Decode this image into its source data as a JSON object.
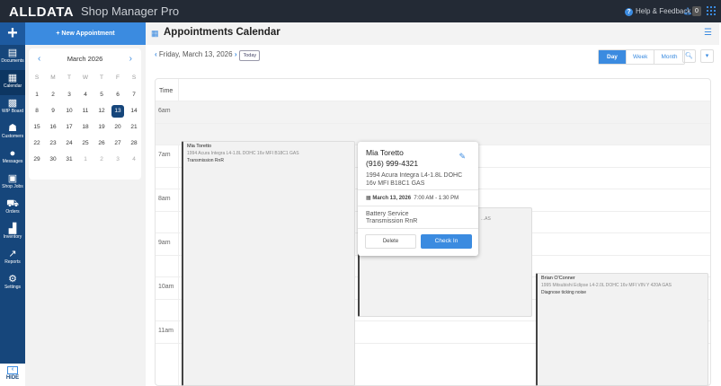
{
  "topbar": {
    "logo": "ALLDATA",
    "product": "Shop Manager Pro",
    "help": "Help & Feedback",
    "notifications": "0"
  },
  "nav": {
    "items": [
      {
        "label": "Documents",
        "icon": "documents-icon"
      },
      {
        "label": "Calendar",
        "icon": "calendar-icon"
      },
      {
        "label": "WIP Board",
        "icon": "grid-icon"
      },
      {
        "label": "Customers",
        "icon": "customers-icon"
      },
      {
        "label": "Messages",
        "icon": "messages-icon"
      },
      {
        "label": "Shop Jobs",
        "icon": "vehicle-icon"
      },
      {
        "label": "Orders",
        "icon": "cart-icon"
      },
      {
        "label": "Inventory",
        "icon": "boxes-icon"
      },
      {
        "label": "Reports",
        "icon": "reports-icon"
      },
      {
        "label": "Settings",
        "icon": "gear-icon"
      }
    ],
    "active": "Calendar",
    "hide": "HIDE"
  },
  "sidebar": {
    "new_appointment": "+ New Appointment",
    "month": "March 2026",
    "weekdays": [
      "S",
      "M",
      "T",
      "W",
      "T",
      "F",
      "S"
    ],
    "days": [
      "1",
      "2",
      "3",
      "4",
      "5",
      "6",
      "7",
      "8",
      "9",
      "10",
      "11",
      "12",
      "13",
      "14",
      "15",
      "16",
      "17",
      "18",
      "19",
      "20",
      "21",
      "22",
      "23",
      "24",
      "25",
      "26",
      "27",
      "28",
      "29",
      "30",
      "31",
      "1",
      "2",
      "3",
      "4"
    ],
    "selected": "13"
  },
  "main": {
    "title": "Appointments Calendar",
    "date": "Friday, March 13, 2026",
    "today": "Today",
    "views": [
      "Day",
      "Week",
      "Month"
    ],
    "active_view": "Day",
    "time_header": "Time",
    "hours": [
      "6am",
      "7am",
      "8am",
      "9am",
      "10am",
      "11am"
    ]
  },
  "appointments": [
    {
      "name": "Mia Toretto",
      "vehicle": "1994 Acura Integra L4-1.8L DOHC 16v MFI B18C1 GAS",
      "service": "Transmission RnR"
    },
    {
      "name": "",
      "vehicle": "...AS",
      "service": ""
    },
    {
      "name": "Brian O'Conner",
      "vehicle": "1995 Mitsubishi Eclipse L4-2.0L DOHC 16v MFI VIN Y 420A GAS",
      "service": "Diagnose ticking noise"
    }
  ],
  "popover": {
    "name": "Mia Toretto",
    "phone": "(916) 999-4321",
    "vehicle": "1994 Acura Integra L4-1.8L DOHC 16v MFI B18C1 GAS",
    "date": "March 13, 2026",
    "time": "7:00 AM - 1:30 PM",
    "services": [
      "Battery Service",
      "Transmission RnR"
    ],
    "delete": "Delete",
    "check_in": "Check In"
  },
  "colors": {
    "accent": "#3b8be0",
    "nav": "#16467b",
    "topbar": "#232a35"
  }
}
